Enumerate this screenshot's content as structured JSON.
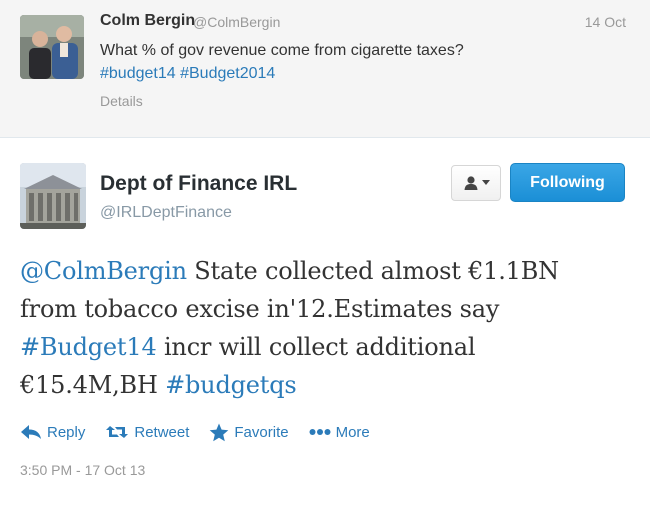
{
  "parent_tweet": {
    "author_name": "Colm Bergin",
    "author_handle": "@ColmBergin",
    "time": "14 Oct",
    "text": "What % of gov revenue come from cigarette taxes?",
    "hashtags": [
      "#budget14",
      "#Budget2014"
    ],
    "details_label": "Details",
    "avatar_icon": "person-photo-avatar"
  },
  "main_tweet": {
    "author_name": "Dept of Finance IRL",
    "author_handle": "@IRLDeptFinance",
    "avatar_icon": "building-photo-avatar",
    "follow_button_label": "Following",
    "user_menu_icon": "user-dropdown-icon",
    "text_parts": {
      "mention": "@ColmBergin",
      "line1_rest": " State collected almost €1.1BN",
      "line2": "from tobacco excise in'12.Estimates say",
      "hashtag1": "#Budget14",
      "line3_rest": " incr will collect additional",
      "line4_start": "€15.4M,BH ",
      "hashtag2": "#budgetqs"
    },
    "actions": {
      "reply": "Reply",
      "retweet": "Retweet",
      "favorite": "Favorite",
      "more": "More"
    },
    "timestamp": "3:50 PM - 17 Oct 13"
  },
  "colors": {
    "link": "#2b7bb9",
    "follow_button": "#2b9ce0",
    "muted": "#999999",
    "parent_background": "#f5f5f5"
  }
}
